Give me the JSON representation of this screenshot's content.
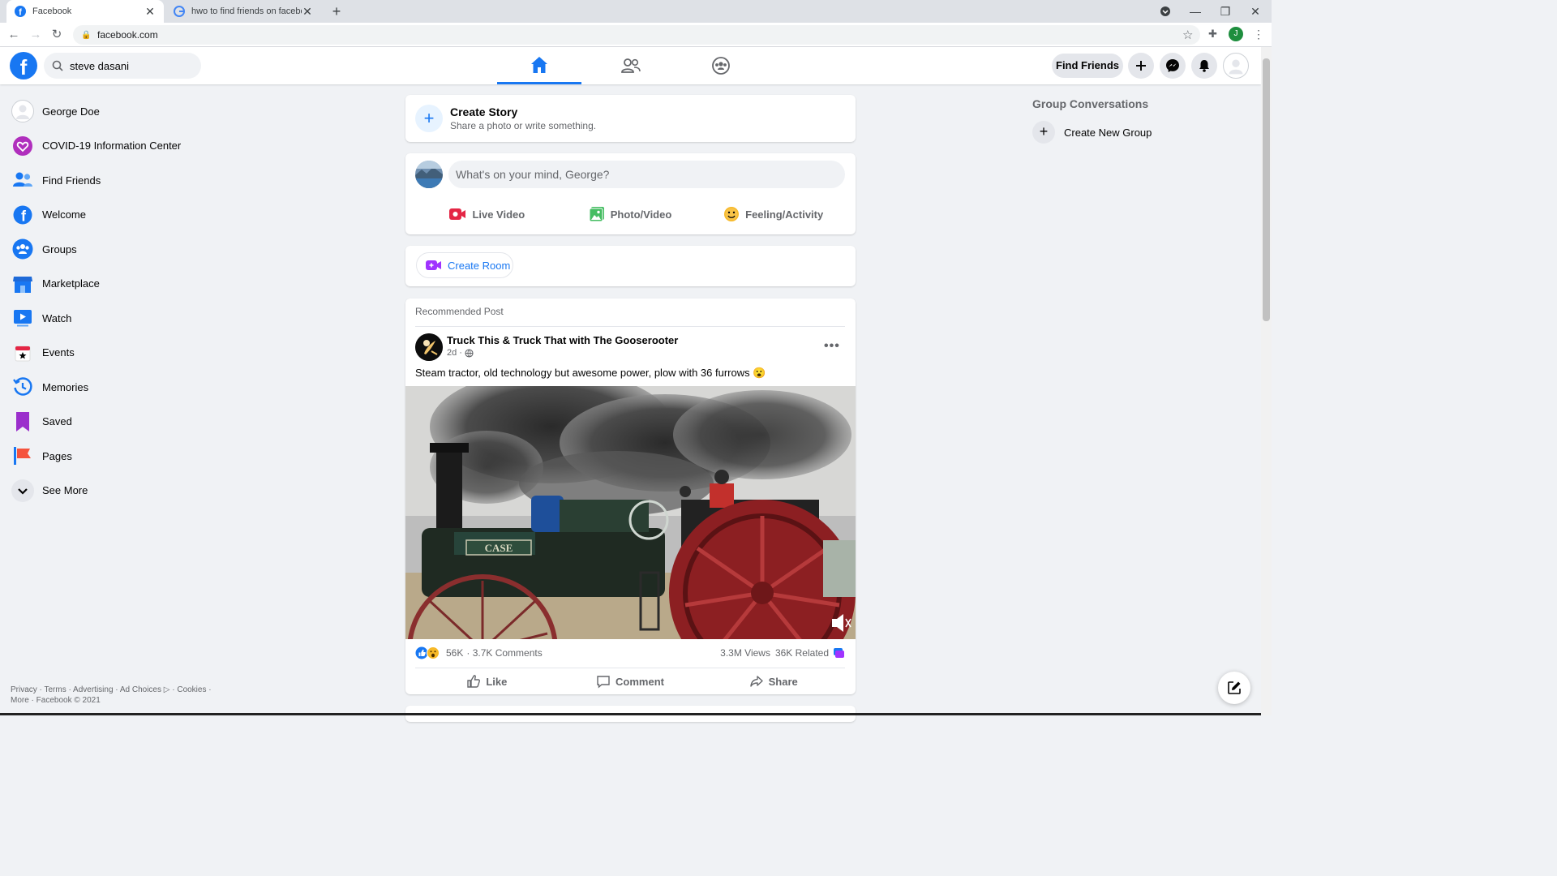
{
  "browser": {
    "tabs": [
      {
        "title": "Facebook",
        "active": true
      },
      {
        "title": "hwo to find friends on facebook",
        "active": false
      }
    ],
    "url": "facebook.com",
    "profile_initial": "J"
  },
  "header": {
    "logo": "f",
    "search_value": "steve dasani",
    "nav_tabs": [
      "home-icon",
      "friends-icon",
      "groups-icon"
    ],
    "find_friends_label": "Find Friends"
  },
  "sidebar": {
    "items": [
      {
        "label": "George Doe",
        "icon": "avatar"
      },
      {
        "label": "COVID-19 Information Center",
        "icon": "covid-heart-icon"
      },
      {
        "label": "Find Friends",
        "icon": "friends-icon"
      },
      {
        "label": "Welcome",
        "icon": "facebook-icon"
      },
      {
        "label": "Groups",
        "icon": "groups-icon"
      },
      {
        "label": "Marketplace",
        "icon": "marketplace-icon"
      },
      {
        "label": "Watch",
        "icon": "watch-icon"
      },
      {
        "label": "Events",
        "icon": "events-icon"
      },
      {
        "label": "Memories",
        "icon": "memories-icon"
      },
      {
        "label": "Saved",
        "icon": "saved-icon"
      },
      {
        "label": "Pages",
        "icon": "pages-icon"
      },
      {
        "label": "See More",
        "icon": "chevron-down-icon"
      }
    ],
    "footer_line1": "Privacy · Terms · Advertising · Ad Choices ▷ · Cookies ·",
    "footer_line2": "More · Facebook © 2021"
  },
  "feed": {
    "story_title": "Create Story",
    "story_subtitle": "Share a photo or write something.",
    "composer_placeholder": "What's on your mind, George?",
    "composer_actions": [
      "Live Video",
      "Photo/Video",
      "Feeling/Activity"
    ],
    "create_room_label": "Create Room",
    "post": {
      "section_label": "Recommended Post",
      "author": "Truck This & Truck That with The Gooserooter",
      "time": "2d ·",
      "text": "Steam tractor, old technology but awesome power, plow with 36 furrows 😮",
      "media_label": "CASE",
      "reactions_count": "56K",
      "comments": "· 3.7K Comments",
      "views": "3.3M Views",
      "related": "36K Related",
      "buttons": [
        "Like",
        "Comment",
        "Share"
      ]
    }
  },
  "right": {
    "title": "Group Conversations",
    "create_group_label": "Create New Group"
  },
  "colors": {
    "brand": "#1877f2",
    "live_video": "#e42645",
    "photo_video": "#45bd62",
    "feeling": "#f7b928",
    "room": "#a033ff"
  }
}
